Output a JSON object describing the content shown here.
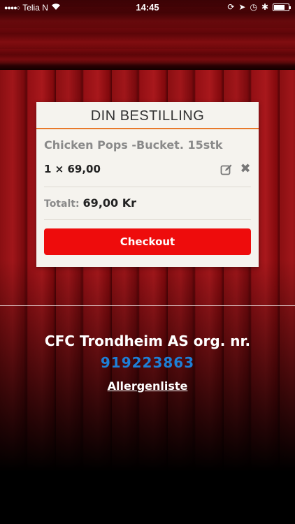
{
  "status_bar": {
    "carrier": "Telia N",
    "time": "14:45",
    "icons": [
      "signal-dots-icon",
      "wifi-icon",
      "lock-rotation-icon",
      "location-icon",
      "alarm-icon",
      "bluetooth-icon",
      "battery-icon"
    ]
  },
  "order": {
    "title": "DIN BESTILLING",
    "items": [
      {
        "name": "Chicken Pops -Bucket. 15stk",
        "quantity_price": "1 × 69,00"
      }
    ],
    "total_label": "Totalt:",
    "total_value": "69,00 Kr",
    "checkout_label": "Checkout"
  },
  "footer": {
    "company": "CFC Trondheim AS org. nr.",
    "org_number": "919223863",
    "allergen_link": "Allergenliste"
  },
  "colors": {
    "accent_orange": "#e8792a",
    "checkout_red": "#ee0c0c",
    "org_number_blue": "#1e7fd6"
  }
}
